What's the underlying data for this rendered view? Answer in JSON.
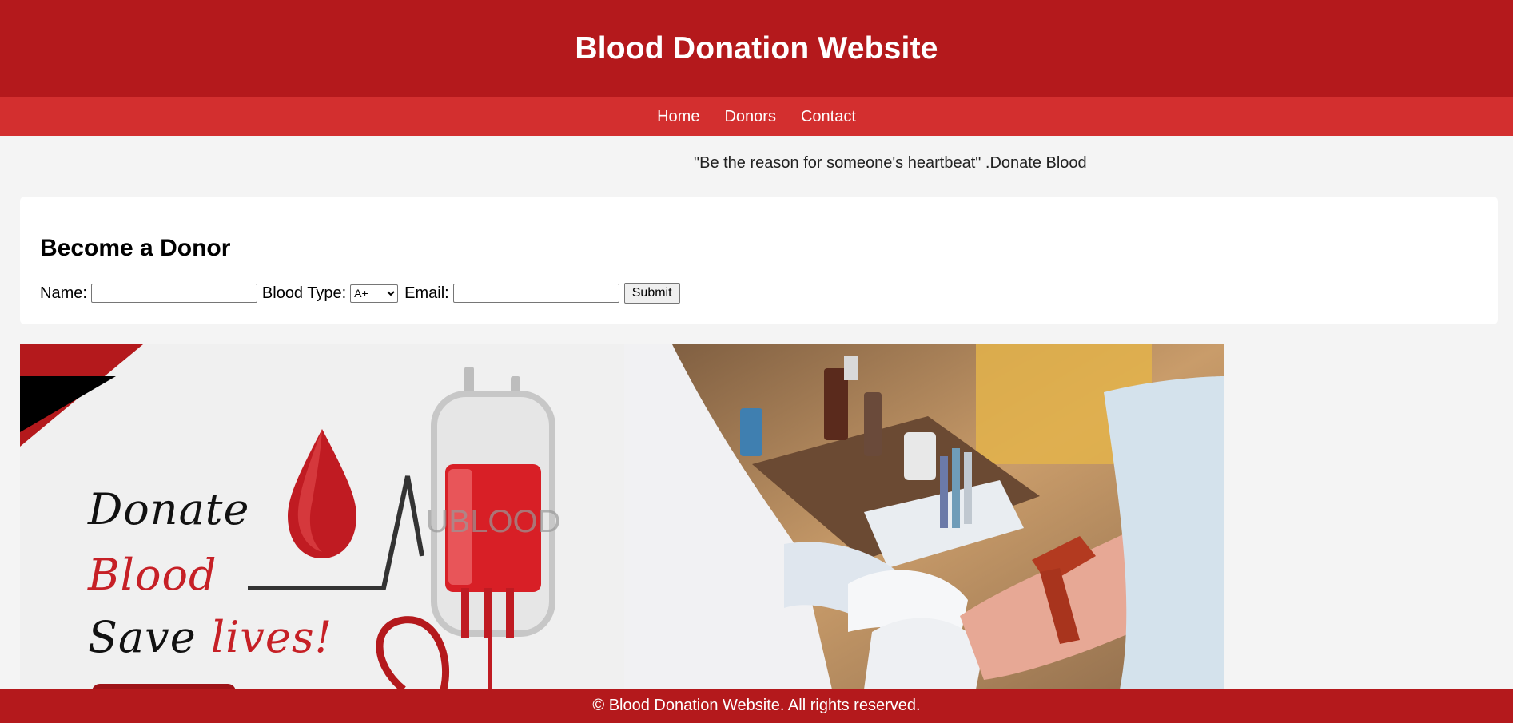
{
  "header": {
    "title": "Blood Donation Website"
  },
  "nav": {
    "items": [
      "Home",
      "Donors",
      "Contact"
    ]
  },
  "tagline": "\"Be the reason for someone's heartbeat\" .Donate Blood",
  "donor_form": {
    "heading": "Become a Donor",
    "name_label": "Name:",
    "name_value": "",
    "blood_type_label": "Blood Type:",
    "blood_type_selected": "A+",
    "email_label": "Email:",
    "email_value": "",
    "submit_label": "Submit"
  },
  "poster": {
    "line1": "Donate",
    "line2": "Blood",
    "line3a": "Save",
    "line3b": "lives!",
    "bag_label": "UBLOOD"
  },
  "footer": {
    "text": "© Blood Donation Website. All rights reserved."
  },
  "colors": {
    "header": "#b4191c",
    "nav": "#d32f2f",
    "background": "#f4f4f4",
    "accent_red": "#d32f2f"
  }
}
